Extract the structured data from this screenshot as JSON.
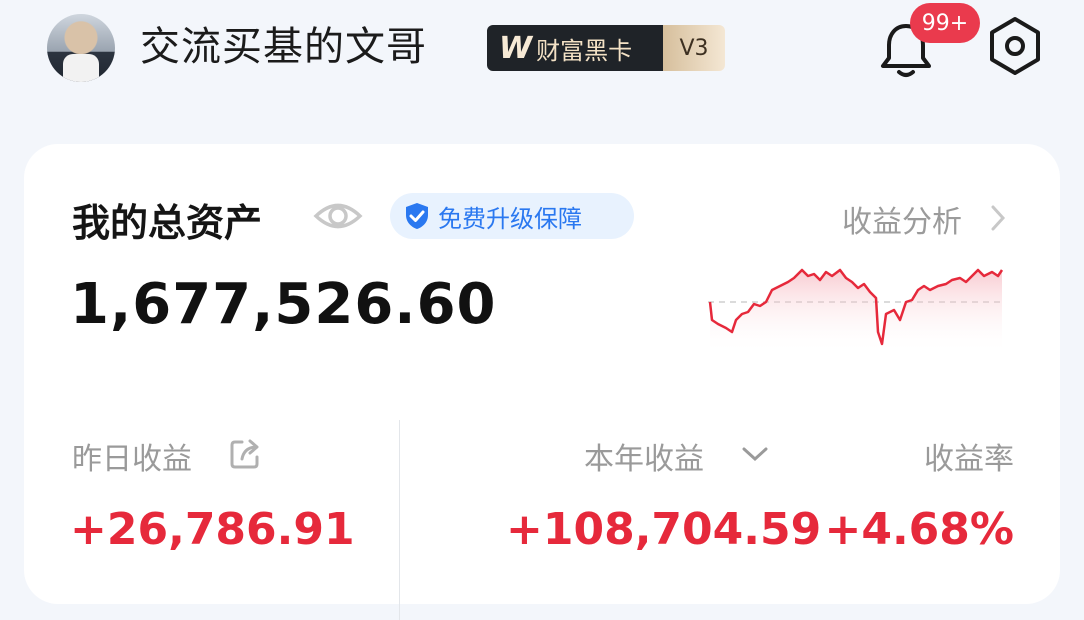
{
  "header": {
    "username": "交流买基的文哥",
    "vip": {
      "logo_text": "W",
      "tier_text": "财富黑卡",
      "level": "V3"
    },
    "notifications_badge": "99+",
    "icons": {
      "avatar": "user-avatar",
      "bell": "bell-icon",
      "settings": "settings-icon"
    }
  },
  "assets_card": {
    "title": "我的总资产",
    "guarantee_label": "免费升级保障",
    "analysis_link": "收益分析",
    "total_amount": "1,677,526.60",
    "yesterday": {
      "label": "昨日收益",
      "value": "+26,786.91"
    },
    "year": {
      "label": "本年收益",
      "value": "+108,704.59"
    },
    "rate": {
      "label": "收益率",
      "value": "+4.68%"
    },
    "colors": {
      "gain": "#e6293b",
      "accent": "#2a78f0"
    }
  }
}
